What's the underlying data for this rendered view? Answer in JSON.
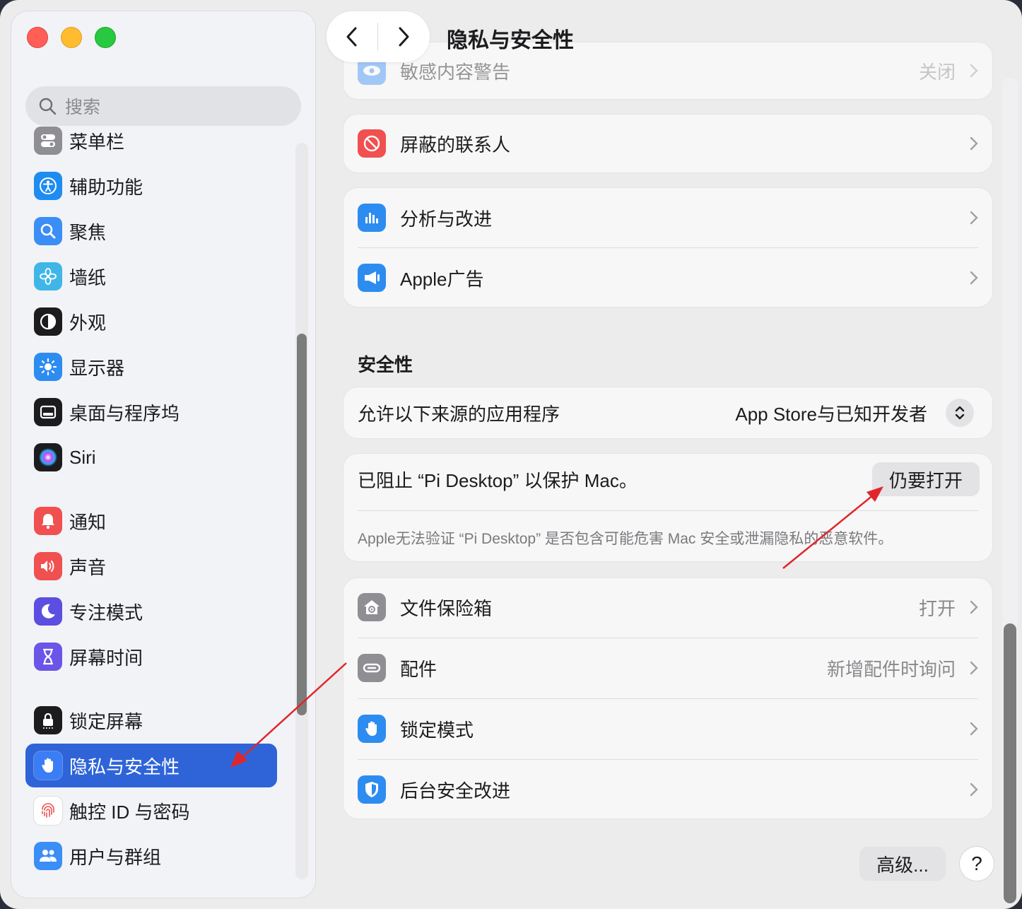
{
  "window": {
    "title": "隐私与安全性"
  },
  "search": {
    "placeholder": "搜索"
  },
  "sidebar": {
    "items": [
      {
        "label": "菜单栏",
        "icon": "menubar-icon",
        "color": "#8e8e93"
      },
      {
        "label": "辅助功能",
        "icon": "accessibility-icon",
        "color": "#1e8cf0"
      },
      {
        "label": "聚焦",
        "icon": "spotlight-icon",
        "color": "#3a8ef5"
      },
      {
        "label": "墙纸",
        "icon": "wallpaper-icon",
        "color": "#40b6e8"
      },
      {
        "label": "外观",
        "icon": "appearance-icon",
        "color": "#1c1c1e"
      },
      {
        "label": "显示器",
        "icon": "display-icon",
        "color": "#2d8cf0"
      },
      {
        "label": "桌面与程序坞",
        "icon": "dock-icon",
        "color": "#1c1c1e"
      },
      {
        "label": "Siri",
        "icon": "siri-icon",
        "color": "#1c1c1e"
      },
      {
        "label": "通知",
        "icon": "notification-icon",
        "color": "#f0504f"
      },
      {
        "label": "声音",
        "icon": "sound-icon",
        "color": "#f0504f"
      },
      {
        "label": "专注模式",
        "icon": "focus-icon",
        "color": "#5b4ee0"
      },
      {
        "label": "屏幕时间",
        "icon": "screen-time-icon",
        "color": "#6a55e8"
      },
      {
        "label": "锁定屏幕",
        "icon": "lock-screen-icon",
        "color": "#1c1c1e"
      },
      {
        "label": "隐私与安全性",
        "icon": "privacy-hand-icon",
        "color": "#3a7df5"
      },
      {
        "label": "触控 ID 与密码",
        "icon": "fingerprint-icon",
        "color": "#ffffff"
      },
      {
        "label": "用户与群组",
        "icon": "users-icon",
        "color": "#3a8ef5"
      }
    ]
  },
  "main": {
    "top_row": {
      "label": "敏感内容警告",
      "value": "关闭"
    },
    "blocked_contacts": {
      "label": "屏蔽的联系人"
    },
    "analytics": {
      "label": "分析与改进"
    },
    "apple_ads": {
      "label": "Apple广告"
    },
    "security_title": "安全性",
    "allow_apps": {
      "label": "允许以下来源的应用程序",
      "value": "App Store与已知开发者"
    },
    "blocked_app": {
      "message": "已阻止 “Pi Desktop” 以保护 Mac。",
      "button": "仍要打开",
      "detail": "Apple无法验证 “Pi Desktop” 是否包含可能危害 Mac 安全或泄漏隐私的恶意软件。"
    },
    "filevault": {
      "label": "文件保险箱",
      "value": "打开"
    },
    "accessories": {
      "label": "配件",
      "value": "新增配件时询问"
    },
    "lockdown": {
      "label": "锁定模式"
    },
    "bg_security": {
      "label": "后台安全改进"
    },
    "advanced_button": "高级...",
    "help_button": "?"
  },
  "colors": {
    "accent": "#2f64d8",
    "annotation_arrow": "#e0262a"
  }
}
